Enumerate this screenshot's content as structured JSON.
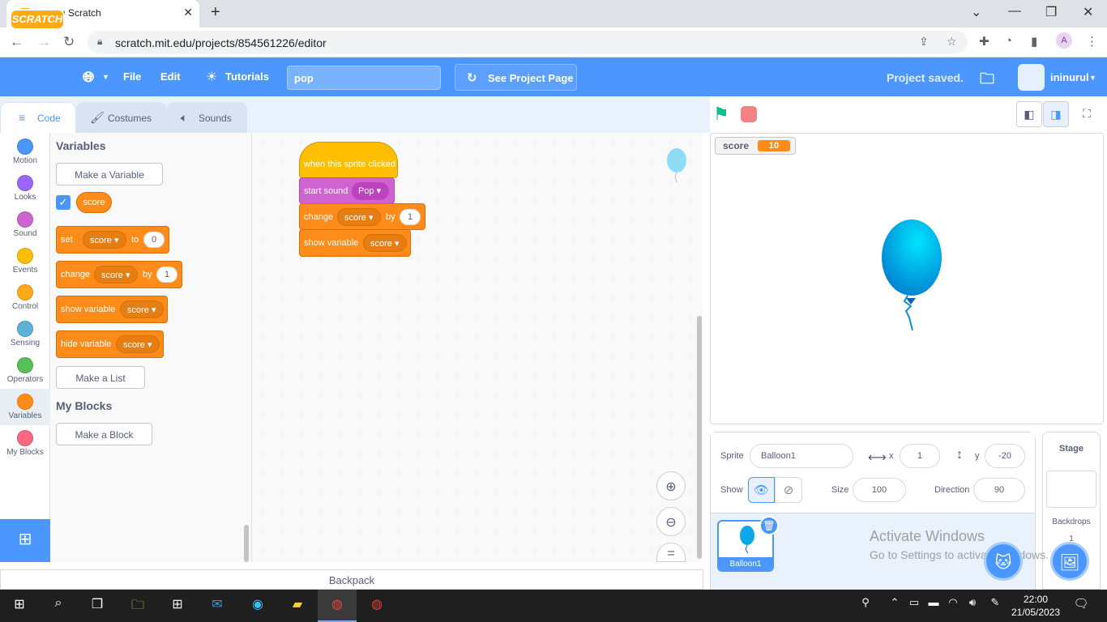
{
  "browser": {
    "tab_title": "pop on Scratch",
    "url": "scratch.mit.edu/projects/854561226/editor"
  },
  "menubar": {
    "logo": "SCRATCH",
    "file": "File",
    "edit": "Edit",
    "tutorials": "Tutorials",
    "project_title": "pop",
    "see_project_page": "See Project Page",
    "status": "Project saved.",
    "username": "ininurul"
  },
  "editor_tabs": [
    "Code",
    "Costumes",
    "Sounds"
  ],
  "categories": [
    {
      "label": "Motion",
      "color": "#4c97ff"
    },
    {
      "label": "Looks",
      "color": "#9966ff"
    },
    {
      "label": "Sound",
      "color": "#cf63cf"
    },
    {
      "label": "Events",
      "color": "#ffbf00"
    },
    {
      "label": "Control",
      "color": "#ffab19"
    },
    {
      "label": "Sensing",
      "color": "#5cb1d6"
    },
    {
      "label": "Operators",
      "color": "#59c059"
    },
    {
      "label": "Variables",
      "color": "#ff8c1a"
    },
    {
      "label": "My Blocks",
      "color": "#ff6680"
    }
  ],
  "palette": {
    "heading": "Variables",
    "make_variable": "Make a Variable",
    "variable_name": "score",
    "set_block": {
      "label": "set",
      "var": "score",
      "to": "to",
      "value": "0"
    },
    "change_block": {
      "label": "change",
      "var": "score",
      "by": "by",
      "value": "1"
    },
    "show_block": {
      "label": "show variable",
      "var": "score"
    },
    "hide_block": {
      "label": "hide variable",
      "var": "score"
    },
    "make_list": "Make a List",
    "myblocks_heading": "My Blocks",
    "make_block": "Make a Block"
  },
  "script": {
    "hat": "when this sprite clicked",
    "sound": {
      "label": "start sound",
      "value": "Pop"
    },
    "change": {
      "label": "change",
      "var": "score",
      "by": "by",
      "value": "1"
    },
    "show": {
      "label": "show variable",
      "var": "score"
    }
  },
  "backpack": "Backpack",
  "stage": {
    "monitor_label": "score",
    "monitor_value": "10"
  },
  "sprite_info": {
    "sprite_label": "Sprite",
    "sprite_name": "Balloon1",
    "x_label": "x",
    "x_value": "1",
    "y_label": "y",
    "y_value": "-20",
    "show_label": "Show",
    "size_label": "Size",
    "size_value": "100",
    "direction_label": "Direction",
    "direction_value": "90"
  },
  "sprite_card": "Balloon1",
  "stage_pane": {
    "title": "Stage",
    "backdrops_label": "Backdrops",
    "backdrops_count": "1"
  },
  "watermark": {
    "line1": "Activate Windows",
    "line2": "Go to Settings to activate Windows."
  },
  "clock": {
    "time": "22:00",
    "date": "21/05/2023"
  }
}
